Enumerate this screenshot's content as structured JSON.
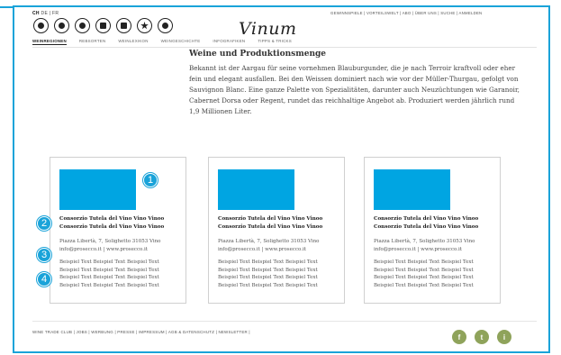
{
  "header": {
    "languages": {
      "active": "CH",
      "others": "DE | FR"
    },
    "top_menu": "GEWINNSPIELE  |  VORTEILSWELT  |  ABO  |  ÜBER UNS  |  SUCHE  |  ANMELDEN",
    "logo": "Vinum",
    "icons": [
      "wine-glass-icon",
      "globe-icon",
      "grape-icon",
      "bottle-icon",
      "book-icon",
      "star-icon",
      "chef-hat-icon"
    ]
  },
  "nav": {
    "items": [
      "WEINREGIONEN",
      "REBSORTEN",
      "WEINLEXIKON",
      "WEINGESCHICHTE",
      "INFOGRAFIKEN",
      "TIPPS & TRICKS"
    ],
    "active": 0
  },
  "section": {
    "title": "Weine und Produktionsmenge",
    "intro": "Bekannt ist der Aargau für seine vornehmen Blauburgunder, die je nach Terroir kraftvoll oder eher fein und elegant ausfallen. Bei den Weissen dominiert nach wie vor der Müller-Thurgau, gefolgt von Sauvignon Blanc. Eine ganze Palette von Spezialitäten, darunter auch Neuzüchtungen wie Garanoir, Cabernet Dorsa oder Regent, rundet das reichhaltige Angebot ab. Produziert werden jährlich rund 1,9 Millionen Liter."
  },
  "cards": [
    {
      "title_line1": "Consorzio Tutela del Vino Vino Vinoo",
      "title_line2": "Consorzio Tutela del Vino Vino Vinoo",
      "address": "Piazza Libertà, 7, Solighetto 31053 Vino",
      "contact": "info@prosecco.it | www.prosecco.it",
      "desc": [
        "Beispiel Text Beispiel Text Beispiel Text",
        "Beispiel Text Beispiel Text Beispiel Text",
        "Beispiel Text Beispiel Text Beispiel Text",
        "Beispiel Text Beispiel Text Beispiel Text"
      ]
    },
    {
      "title_line1": "Consorzio Tutela del Vino Vino Vinoo",
      "title_line2": "Consorzio Tutela del Vino Vino Vinoo",
      "address": "Piazza Libertà, 7, Solighetto 31053 Vino",
      "contact": "info@prosecco.it | www.prosecco.it",
      "desc": [
        "Beispiel Text Beispiel Text Beispiel Text",
        "Beispiel Text Beispiel Text Beispiel Text",
        "Beispiel Text Beispiel Text Beispiel Text",
        "Beispiel Text Beispiel Text Beispiel Text"
      ]
    },
    {
      "title_line1": "Consorzio Tutela del Vino Vino Vinoo",
      "title_line2": "Consorzio Tutela del Vino Vino Vinoo",
      "address": "Piazza Libertà, 7, Solighetto 31053 Vino",
      "contact": "info@prosecco.it | www.prosecco.it",
      "desc": [
        "Beispiel Text Beispiel Text Beispiel Text",
        "Beispiel Text Beispiel Text Beispiel Text",
        "Beispiel Text Beispiel Text Beispiel Text",
        "Beispiel Text Beispiel Text Beispiel Text"
      ]
    }
  ],
  "markers": [
    "1",
    "2",
    "3",
    "4"
  ],
  "footer": {
    "links": "WINE TRADE CLUB  |  JOBS  |  WERBUNG  |  PRESSE  |  IMPRESSUM  |  AGB & DATENSCHUTZ  |  NEWSLETTER  |",
    "social": [
      "f",
      "t",
      "i"
    ]
  },
  "colors": {
    "accent": "#1aa3d9",
    "image_placeholder": "#00a5e2",
    "social": "#8fa35b"
  }
}
